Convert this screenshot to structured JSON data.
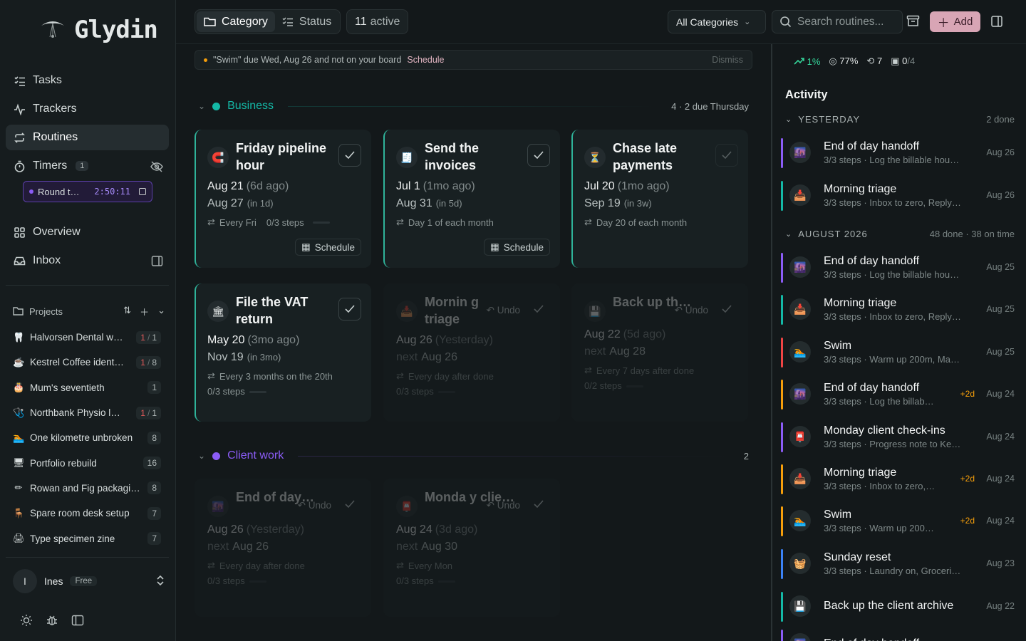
{
  "brand": {
    "name": "Glydin"
  },
  "nav": {
    "tasks": "Tasks",
    "trackers": "Trackers",
    "routines": "Routines",
    "timers": "Timers",
    "timers_count": "1",
    "overview": "Overview",
    "inbox": "Inbox"
  },
  "timer": {
    "label": "Round t…",
    "time": "2:50:11"
  },
  "projects": {
    "heading": "Projects",
    "items": [
      {
        "icon": "🦷",
        "name": "Halvorsen Dental w…",
        "done": "1",
        "sep": "/",
        "total": "1"
      },
      {
        "icon": "☕",
        "name": "Kestrel Coffee ident…",
        "done": "1",
        "sep": "/",
        "total": "8"
      },
      {
        "icon": "🎂",
        "name": "Mum's seventieth",
        "count": "1"
      },
      {
        "icon": "🩺",
        "name": "Northbank Physio l…",
        "done": "1",
        "sep": "/",
        "total": "1"
      },
      {
        "icon": "🏊",
        "name": "One kilometre unbroken",
        "count": "8"
      },
      {
        "icon": "🖥",
        "name": "Portfolio rebuild",
        "count": "16"
      },
      {
        "icon": "✏",
        "name": "Rowan and Fig packagi…",
        "count": "8"
      },
      {
        "icon": "🪑",
        "name": "Spare room desk setup",
        "count": "7"
      },
      {
        "icon": "🖨",
        "name": "Type specimen zine",
        "count": "7"
      }
    ]
  },
  "user": {
    "initial": "I",
    "name": "Ines",
    "plan": "Free"
  },
  "toolbar": {
    "category": "Category",
    "status": "Status",
    "active_count": "11",
    "active_label": "active",
    "category_select": "All Categories",
    "search_placeholder": "Search routines...",
    "add": "Add"
  },
  "notice": {
    "text": "\"Swim\" due Wed, Aug 26 and not on your board",
    "action": "Schedule",
    "dismiss": "Dismiss"
  },
  "groups": {
    "business": {
      "name": "Business",
      "meta": "4 · 2 due Thursday",
      "color": "#14b8a6"
    },
    "client": {
      "name": "Client work",
      "meta": "2",
      "color": "#8b5cf6"
    }
  },
  "cards": [
    {
      "icon": "🧲",
      "title": "Friday pipeline hour",
      "last": "Aug 21",
      "last_rel": "(6d ago)",
      "next": "Aug 27",
      "next_rel": "(in 1d)",
      "repeat": "Every Fri",
      "steps": "0/3 steps",
      "action": "Schedule"
    },
    {
      "icon": "🧾",
      "title": "Send the invoices",
      "last": "Jul 1",
      "last_rel": "(1mo ago)",
      "next": "Aug 31",
      "next_rel": "(in 5d)",
      "repeat": "Day 1 of each month",
      "action": "Schedule"
    },
    {
      "icon": "⏳",
      "title": "Chase late payments",
      "last": "Jul 20",
      "last_rel": "(1mo ago)",
      "next": "Sep 19",
      "next_rel": "(in 3w)",
      "repeat": "Day 20 of each month"
    },
    {
      "icon": "🏛",
      "title": "File the VAT return",
      "last": "May 20",
      "last_rel": "(3mo ago)",
      "next": "Nov 19",
      "next_rel": "(in 3mo)",
      "repeat": "Every 3 months on the 20th",
      "steps": "0/3 steps"
    },
    {
      "icon": "📥",
      "title": "Mornin g triage",
      "last": "Aug 26",
      "last_rel": "(Yesterday)",
      "next_prefix": "next",
      "next": "Aug 26",
      "repeat": "Every day after done",
      "steps": "0/3 steps",
      "undo": "Undo"
    },
    {
      "icon": "💾",
      "title": "Back up th…",
      "last": "Aug 22",
      "last_rel": "(5d ago)",
      "next_prefix": "next",
      "next": "Aug 28",
      "repeat": "Every 7 days after done",
      "steps": "0/2 steps",
      "undo": "Undo"
    },
    {
      "icon": "🌆",
      "title": "End of day…",
      "last": "Aug 26",
      "last_rel": "(Yesterday)",
      "next_prefix": "next",
      "next": "Aug 26",
      "repeat": "Every day after done",
      "steps": "0/3 steps",
      "undo": "Undo"
    },
    {
      "icon": "📮",
      "title": "Monda y clie…",
      "last": "Aug 24",
      "last_rel": "(3d ago)",
      "next_prefix": "next",
      "next": "Aug 30",
      "repeat": "Every Mon",
      "steps": "0/3 steps",
      "undo": "Undo"
    }
  ],
  "stats": {
    "trend": "1%",
    "rate": "77%",
    "streak": "7",
    "today": "0",
    "today_total": "/4"
  },
  "activity": {
    "title": "Activity",
    "yesterday": {
      "label": "YESTERDAY",
      "meta": "2 done"
    },
    "august": {
      "label": "AUGUST 2026",
      "meta": "48 done · 38 on time"
    },
    "items": [
      {
        "icon": "🌆",
        "title": "End of day handoff",
        "sub": "3/3 steps · Log the billable hou…",
        "date": "Aug 26",
        "color": "#8b5cf6"
      },
      {
        "icon": "📥",
        "title": "Morning triage",
        "sub": "3/3 steps · Inbox to zero, Reply…",
        "date": "Aug 26",
        "color": "#14b8a6"
      },
      {
        "icon": "🌆",
        "title": "End of day handoff",
        "sub": "3/3 steps · Log the billable hou…",
        "date": "Aug 25",
        "color": "#8b5cf6"
      },
      {
        "icon": "📥",
        "title": "Morning triage",
        "sub": "3/3 steps · Inbox to zero, Reply…",
        "date": "Aug 25",
        "color": "#14b8a6"
      },
      {
        "icon": "🏊",
        "title": "Swim",
        "sub": "3/3 steps · Warm up 200m, Ma…",
        "date": "Aug 25",
        "color": "#ef4444"
      },
      {
        "icon": "🌆",
        "title": "End of day handoff",
        "sub": "3/3 steps · Log the billab…",
        "late": "+2d",
        "date": "Aug 24",
        "color": "#f59e0b"
      },
      {
        "icon": "📮",
        "title": "Monday client check-ins",
        "sub": "3/3 steps · Progress note to Ke…",
        "date": "Aug 24",
        "color": "#8b5cf6"
      },
      {
        "icon": "📥",
        "title": "Morning triage",
        "sub": "3/3 steps · Inbox to zero,…",
        "late": "+2d",
        "date": "Aug 24",
        "color": "#f59e0b"
      },
      {
        "icon": "🏊",
        "title": "Swim",
        "sub": "3/3 steps · Warm up 200…",
        "late": "+2d",
        "date": "Aug 24",
        "color": "#f59e0b"
      },
      {
        "icon": "🧺",
        "title": "Sunday reset",
        "sub": "3/3 steps · Laundry on, Groceri…",
        "date": "Aug 23",
        "color": "#3b82f6"
      },
      {
        "icon": "💾",
        "title": "Back up the client archive",
        "sub": "",
        "date": "Aug 22",
        "color": "#14b8a6"
      },
      {
        "icon": "🌆",
        "title": "End of day handoff",
        "sub": "",
        "date": "",
        "color": "#8b5cf6"
      }
    ]
  }
}
